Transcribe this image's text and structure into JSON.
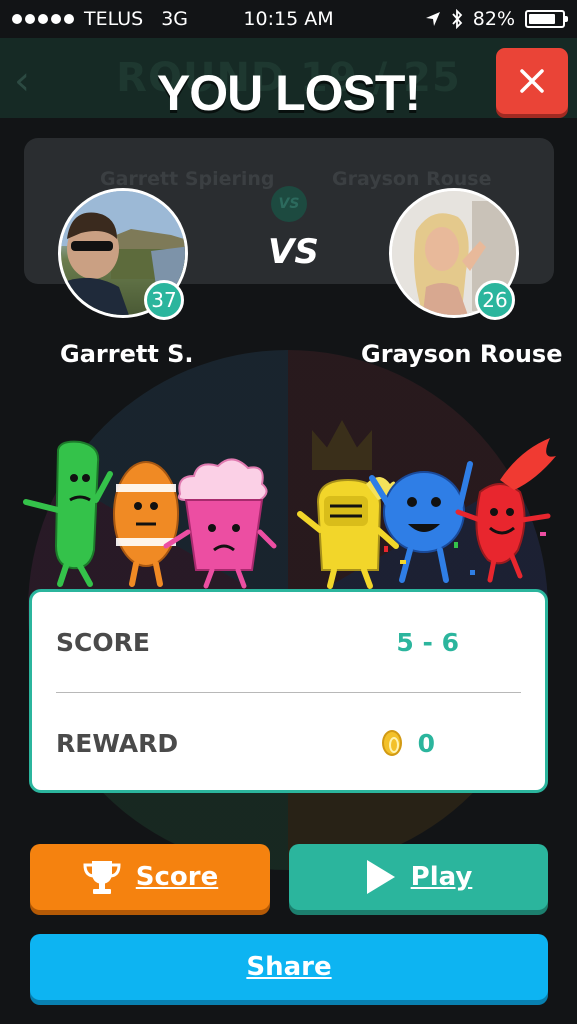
{
  "status_bar": {
    "carrier": "TELUS",
    "network": "3G",
    "time": "10:15 AM",
    "battery": "82%",
    "battery_level": 0.82
  },
  "background": {
    "round_title": "ROUND 19 / 25",
    "left_name": "Garrett Spiering",
    "right_name": "Grayson Rouse",
    "vs": "VS"
  },
  "result": {
    "title": "YOU LOST!",
    "vs": "VS"
  },
  "players": [
    {
      "name": "Garrett S.",
      "level": "37"
    },
    {
      "name": "Grayson Rouse",
      "level": "26"
    }
  ],
  "score_card": {
    "score_label": "SCORE",
    "score_value": "5 - 6",
    "reward_label": "REWARD",
    "reward_value": "0"
  },
  "buttons": {
    "score": "Score",
    "play": "Play",
    "share": "Share"
  },
  "colors": {
    "accent": "#2bb59d",
    "close": "#ea4437",
    "score_button": "#f5820f",
    "play_button": "#2bb59d",
    "share_button": "#0db4f2"
  }
}
